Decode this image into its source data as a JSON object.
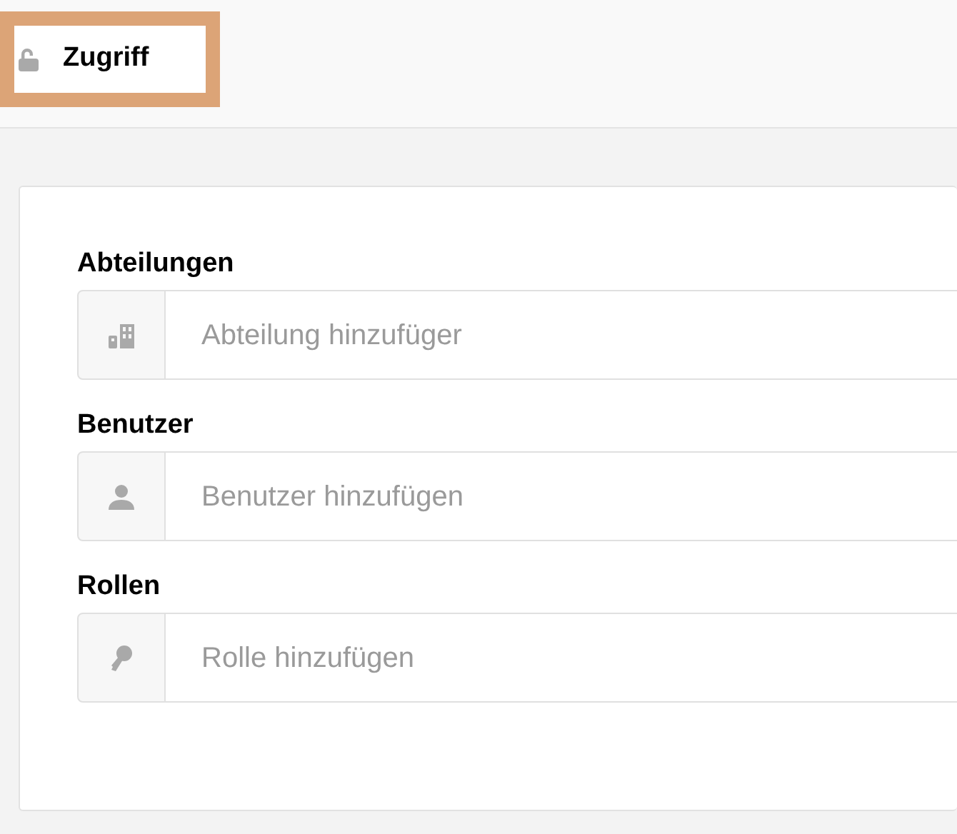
{
  "header": {
    "title": "Zugriff",
    "highlighted": true
  },
  "fields": [
    {
      "label": "Abteilungen",
      "kind": "building",
      "placeholder": "Abteilung hinzufüger"
    },
    {
      "label": "Benutzer",
      "kind": "user",
      "placeholder": "Benutzer hinzufügen"
    },
    {
      "label": "Rollen",
      "kind": "key",
      "placeholder": "Rolle hinzufügen"
    }
  ]
}
